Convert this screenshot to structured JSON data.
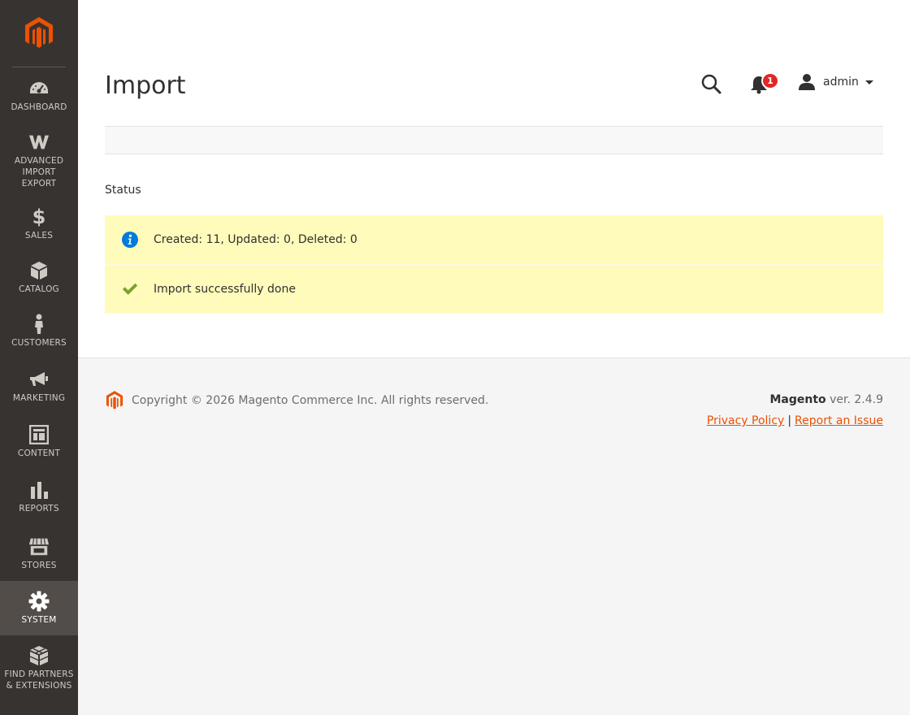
{
  "sidebar": {
    "items": [
      {
        "label": "DASHBOARD",
        "icon": "dashboard-icon"
      },
      {
        "label": "ADVANCED\nIMPORT\nEXPORT",
        "icon": "advanced-import-export-icon"
      },
      {
        "label": "SALES",
        "icon": "dollar-icon"
      },
      {
        "label": "CATALOG",
        "icon": "box-icon"
      },
      {
        "label": "CUSTOMERS",
        "icon": "person-icon"
      },
      {
        "label": "MARKETING",
        "icon": "megaphone-icon"
      },
      {
        "label": "CONTENT",
        "icon": "layout-icon"
      },
      {
        "label": "REPORTS",
        "icon": "bar-chart-icon"
      },
      {
        "label": "STORES",
        "icon": "storefront-icon"
      },
      {
        "label": "SYSTEM",
        "icon": "gear-icon"
      },
      {
        "label": "FIND PARTNERS\n& EXTENSIONS",
        "icon": "extensions-icon"
      }
    ],
    "active": "SYSTEM"
  },
  "header": {
    "title": "Import",
    "notifications_count": "1",
    "user": "admin"
  },
  "status": {
    "label": "Status",
    "messages": [
      {
        "type": "info",
        "text": "Created: 11, Updated: 0, Deleted: 0"
      },
      {
        "type": "success",
        "text": "Import successfully done"
      }
    ]
  },
  "footer": {
    "copyright": "Copyright © 2026 Magento Commerce Inc. All rights reserved.",
    "brand": "Magento",
    "version": "ver. 2.4.9",
    "privacy_policy": "Privacy Policy",
    "separator": "|",
    "report_issue": "Report an Issue"
  },
  "colors": {
    "sidebar_bg": "#373330",
    "sidebar_active": "#524d49",
    "brand_orange": "#eb5202",
    "message_bg": "#fffbbb",
    "badge_red": "#e22626",
    "info_blue": "#007bdb",
    "success_green": "#79a22e"
  }
}
